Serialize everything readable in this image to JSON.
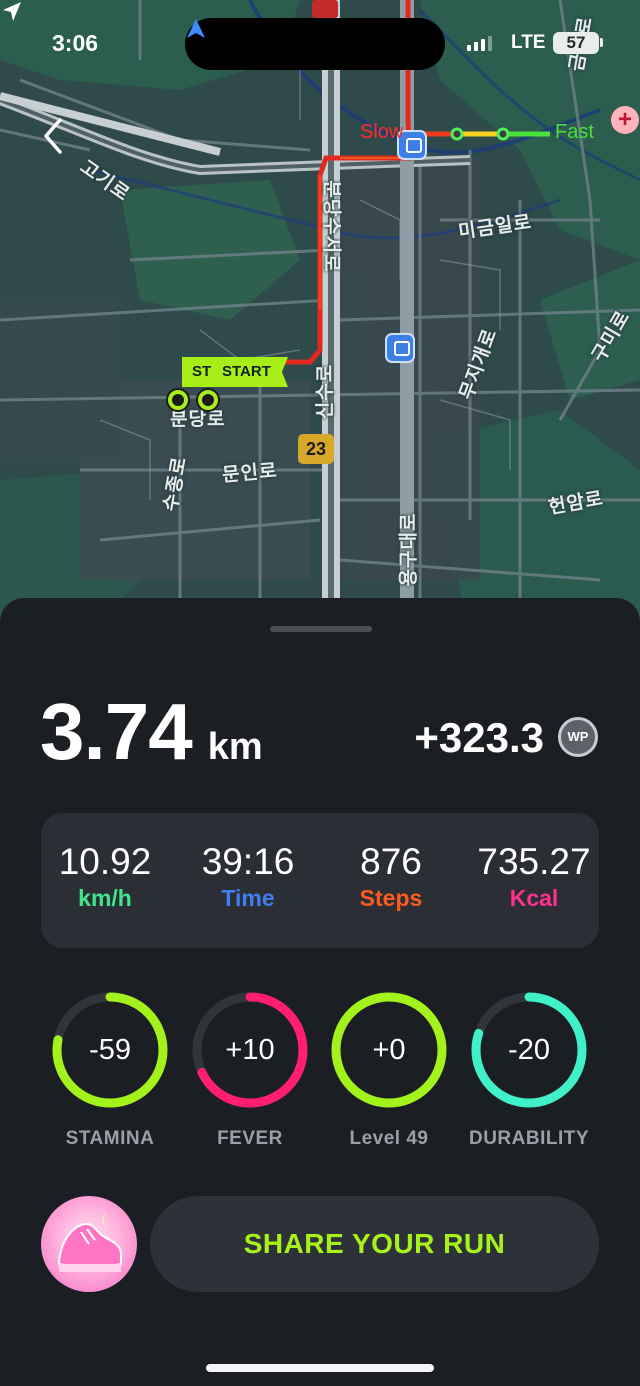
{
  "status_bar": {
    "time": "3:06",
    "network": "LTE",
    "battery": "57"
  },
  "map": {
    "legend": {
      "slow": "Slow",
      "fast": "Fast"
    },
    "labels": [
      "고기로",
      "분당수서로",
      "미금일로",
      "무지개로",
      "구미로",
      "신수로",
      "문인로",
      "수종로",
      "분당로",
      "용구대로",
      "헌암로",
      "금곡로"
    ],
    "route_badge": "23",
    "start_short": "ST",
    "start_label": "START"
  },
  "summary": {
    "distance_value": "3.74",
    "distance_unit": "km",
    "wp_amount": "+323.3",
    "wp_coin": "WP"
  },
  "stats": [
    {
      "value": "10.92",
      "label": "km/h",
      "color": "#3ee88a"
    },
    {
      "value": "39:16",
      "label": "Time",
      "color": "#3f7df0"
    },
    {
      "value": "876",
      "label": "Steps",
      "color": "#ff5a1f"
    },
    {
      "value": "735.27",
      "label": "Kcal",
      "color": "#ff2f8e"
    }
  ],
  "gauges": [
    {
      "value": "-59",
      "label": "STAMINA",
      "fraction": 0.78,
      "color": "#a3f21b"
    },
    {
      "value": "+10",
      "label": "FEVER",
      "fraction": 0.68,
      "color": "#ff1f6e"
    },
    {
      "value": "+0",
      "label": "Level 49",
      "fraction": 1.0,
      "color": "#a3f21b"
    },
    {
      "value": "-20",
      "label": "DURABILITY",
      "fraction": 0.8,
      "color": "#3ff0c8"
    }
  ],
  "share_label": "SHARE YOUR RUN"
}
